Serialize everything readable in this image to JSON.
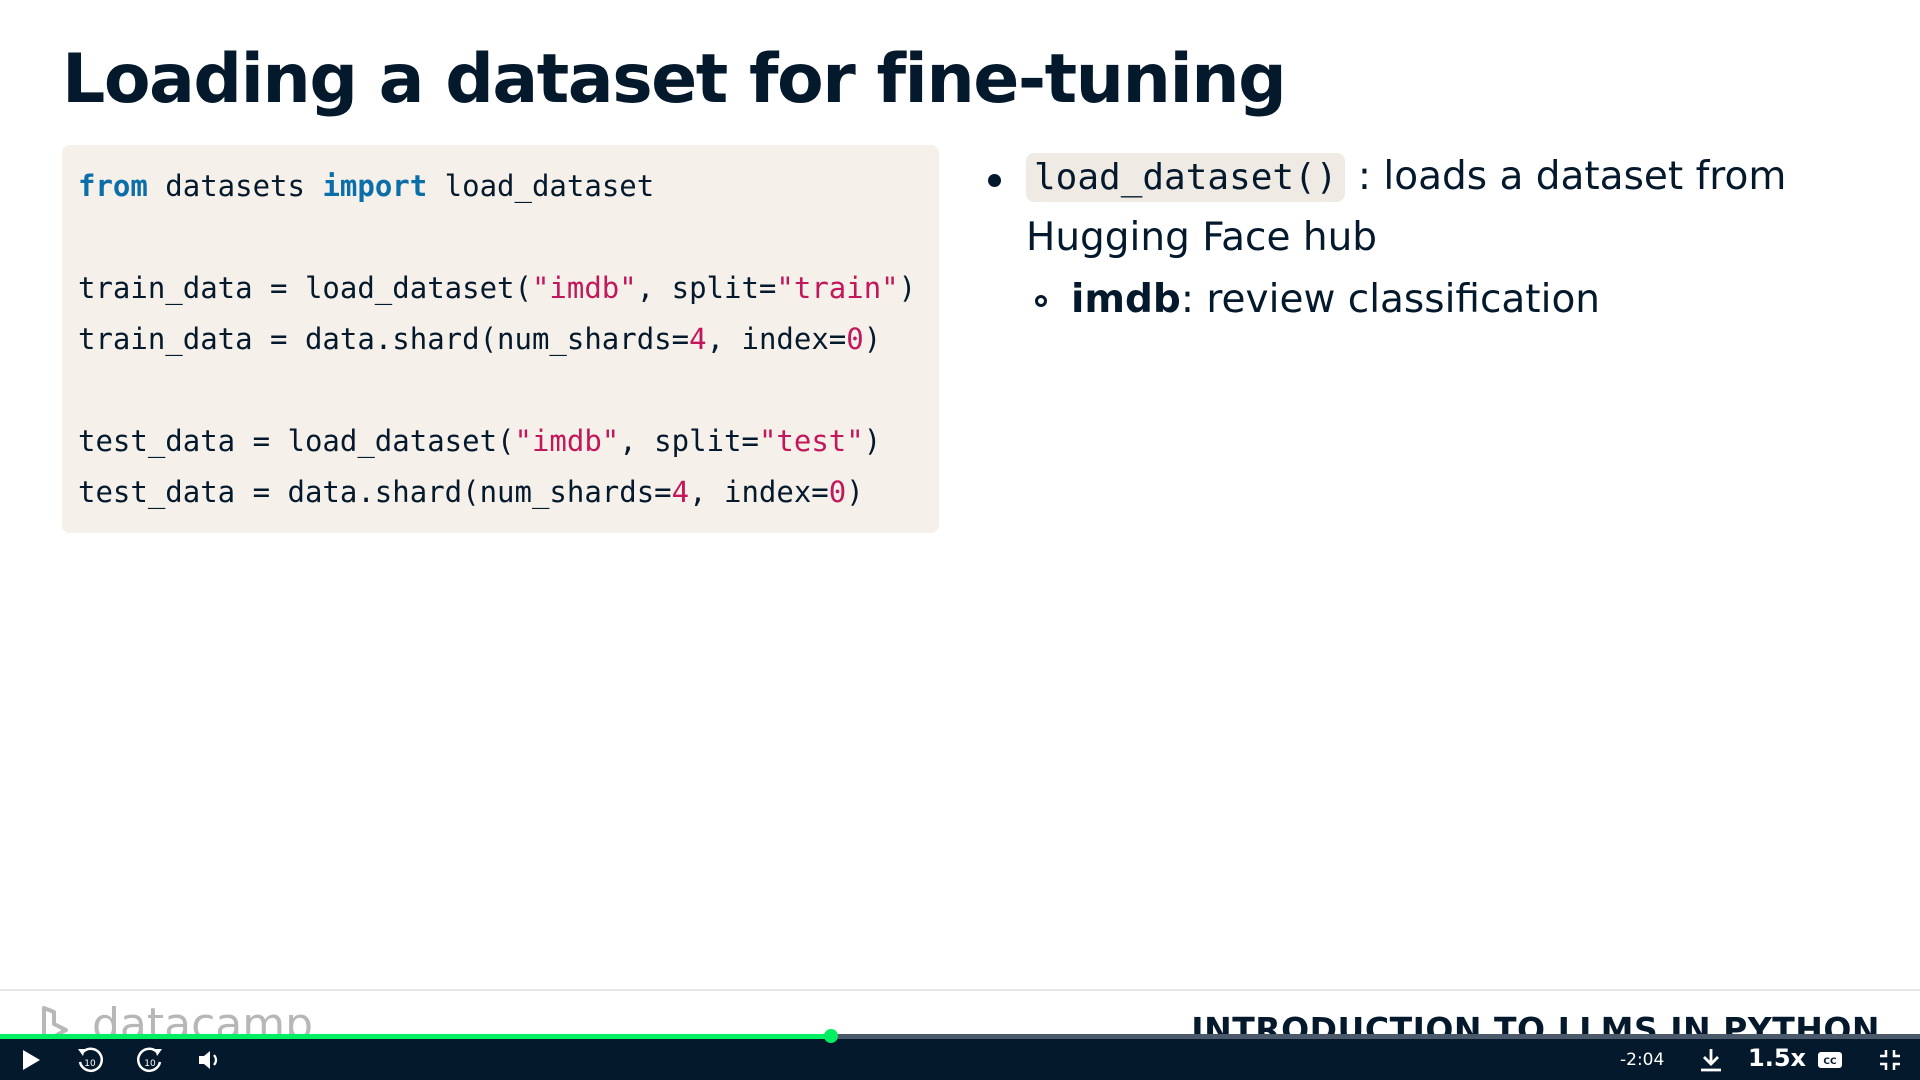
{
  "slide": {
    "title": "Loading a dataset for fine-tuning",
    "code": {
      "line1": {
        "kw1": "from",
        "mod": " datasets ",
        "kw2": "import",
        "fn": " load_dataset"
      },
      "line3": {
        "a": "train_data = load_dataset(",
        "s1": "\"imdb\"",
        "b": ", split=",
        "s2": "\"train\"",
        "c": ")"
      },
      "line4": {
        "a": "train_data = data.shard(num_shards=",
        "n1": "4",
        "b": ", index=",
        "n2": "0",
        "c": ")"
      },
      "line6": {
        "a": "test_data = load_dataset(",
        "s1": "\"imdb\"",
        "b": ", split=",
        "s2": "\"test\"",
        "c": ")"
      },
      "line7": {
        "a": "test_data = data.shard(num_shards=",
        "n1": "4",
        "b": ", index=",
        "n2": "0",
        "c": ")"
      }
    },
    "bullets": {
      "b1_code": "load_dataset()",
      "b1_text": " : loads a dataset from Hugging Face hub",
      "b2_bold": "imdb",
      "b2_text": ": review classification"
    }
  },
  "footer": {
    "brand": "datacamp",
    "course": "INTRODUCTION TO LLMS IN PYTHON"
  },
  "player": {
    "progress_fraction": 0.433,
    "time_remaining": "-2:04",
    "speed": "1.5x",
    "colors": {
      "progress": "#03ef62",
      "bar": "#05192d"
    },
    "icons": [
      "play-icon",
      "rewind-10-icon",
      "forward-10-icon",
      "volume-icon",
      "download-icon",
      "captions-icon",
      "exit-fullscreen-icon"
    ]
  }
}
